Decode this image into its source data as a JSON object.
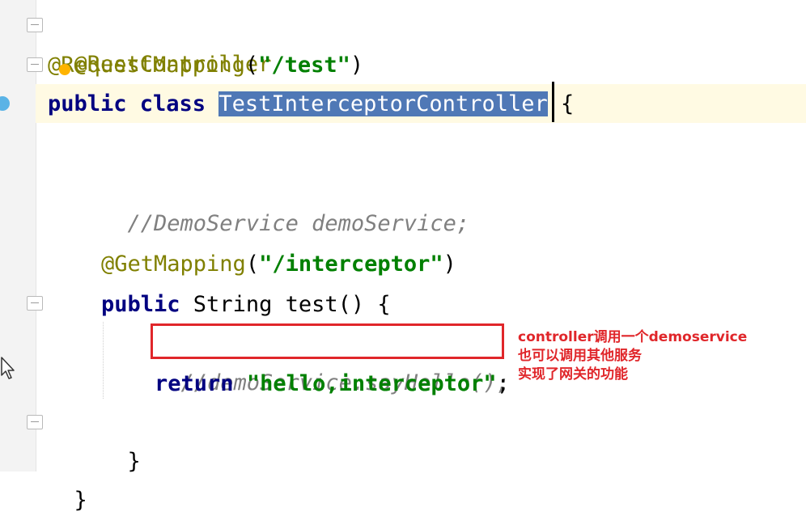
{
  "editor": {
    "lines": [
      {
        "annotation": "@RestController"
      },
      {
        "annotation": "@RequestMapping",
        "open": "(",
        "string": "\"/test\"",
        "close": ")"
      },
      {
        "kw": "public class",
        "space": " ",
        "class_name": "TestInterceptorController",
        "brace": " {"
      },
      {
        "comment": "//DemoService demoService;"
      },
      {
        "annotation": "@GetMapping",
        "open": "(",
        "string": "\"/interceptor\"",
        "close": ")"
      },
      {
        "kw": "public",
        "rest": " String test() {"
      },
      {
        "comment": "//demoService.sayHello();"
      },
      {
        "kw": "return",
        "space": " ",
        "string": "\"hello,interceptor\"",
        "semi": ";"
      },
      {
        "text": "}"
      },
      {
        "text": "}"
      }
    ]
  },
  "note": {
    "lines": [
      "controller调用一个demoservice",
      "也可以调用其他服务",
      "实现了网关的功能"
    ],
    "color": "#e0262a"
  },
  "colors": {
    "selection": "#4f78b6",
    "keyword": "#000080",
    "string": "#008000",
    "annotation": "#808000",
    "comment": "#808080",
    "current_line": "#fffae3"
  }
}
